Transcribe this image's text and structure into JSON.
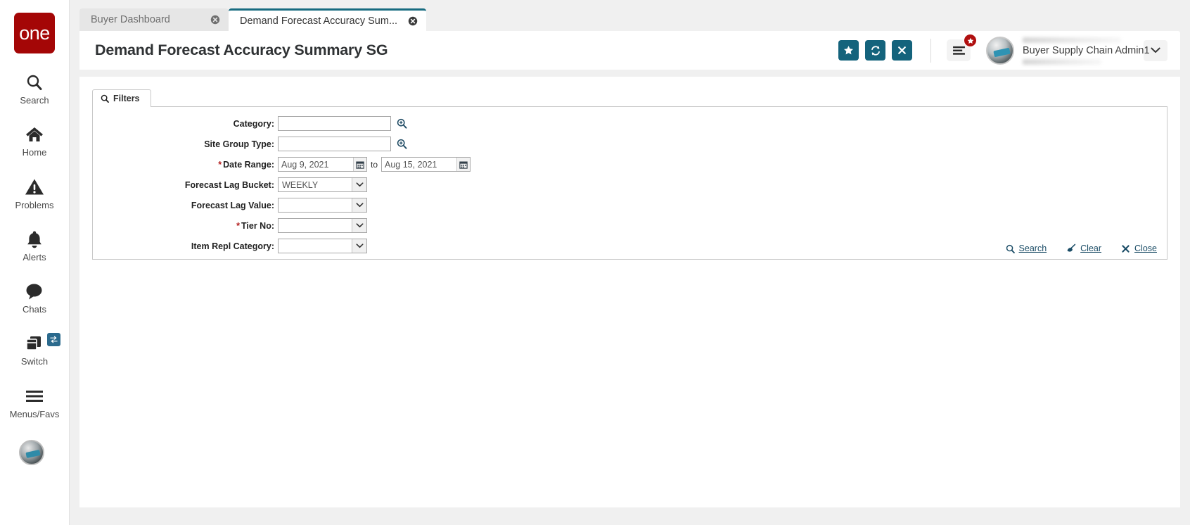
{
  "sidebar": {
    "logo_text": "one",
    "items": [
      {
        "label": "Search",
        "icon": "search-icon"
      },
      {
        "label": "Home",
        "icon": "home-icon"
      },
      {
        "label": "Problems",
        "icon": "warning-triangle-icon"
      },
      {
        "label": "Alerts",
        "icon": "bell-icon"
      },
      {
        "label": "Chats",
        "icon": "chat-bubble-icon"
      },
      {
        "label": "Switch",
        "icon": "windows-stack-icon",
        "badge_icon": "swap-arrows-icon"
      },
      {
        "label": "Menus/Favs",
        "icon": "hamburger-icon"
      }
    ],
    "avatar_icon": "user-avatar-icon"
  },
  "tabs": [
    {
      "label": "Buyer Dashboard",
      "active": false,
      "close_icon": "close-circle-icon"
    },
    {
      "label": "Demand Forecast Accuracy Sum...",
      "active": true,
      "close_icon": "close-circle-icon"
    }
  ],
  "header": {
    "title": "Demand Forecast Accuracy Summary SG",
    "buttons": [
      {
        "name": "favorite-button",
        "icon": "star-icon"
      },
      {
        "name": "refresh-button",
        "icon": "refresh-icon"
      },
      {
        "name": "close-button",
        "icon": "x-icon"
      }
    ],
    "menu_button": {
      "icon": "hamburger-icon",
      "badge_icon": "star-icon"
    },
    "user_name": "Buyer Supply Chain Admin1",
    "caret_icon": "chevron-down-icon",
    "accent_color": "#14637c",
    "badge_color": "#b00f0f",
    "logo_color": "#a40606"
  },
  "filters": {
    "tab_label": "Filters",
    "tab_icon": "search-icon",
    "fields": [
      {
        "label": "Category:",
        "required": false,
        "type": "text-lookup",
        "value": "",
        "lookup_icon": "magnifier-plus-icon"
      },
      {
        "label": "Site Group Type:",
        "required": false,
        "type": "text-lookup",
        "value": "",
        "lookup_icon": "magnifier-plus-icon"
      },
      {
        "label": "Date Range:",
        "required": true,
        "type": "date-range",
        "from_value": "Aug 9, 2021",
        "to_word": "to",
        "to_value": "Aug 15, 2021",
        "calendar_icon": "calendar-icon"
      },
      {
        "label": "Forecast Lag Bucket:",
        "required": false,
        "type": "select",
        "value": "WEEKLY",
        "arrow_icon": "chevron-down-icon"
      },
      {
        "label": "Forecast Lag Value:",
        "required": false,
        "type": "select",
        "value": "",
        "arrow_icon": "chevron-down-icon"
      },
      {
        "label": "Tier No:",
        "required": true,
        "type": "select",
        "value": "",
        "arrow_icon": "chevron-down-icon"
      },
      {
        "label": "Item Repl Category:",
        "required": false,
        "type": "select",
        "value": "",
        "arrow_icon": "chevron-down-icon"
      }
    ],
    "actions": [
      {
        "label": "Search",
        "icon": "search-icon",
        "name": "search-link"
      },
      {
        "label": "Clear",
        "icon": "broom-icon",
        "name": "clear-link"
      },
      {
        "label": "Close",
        "icon": "x-icon",
        "name": "close-link"
      }
    ],
    "link_color": "#1a4c66"
  }
}
